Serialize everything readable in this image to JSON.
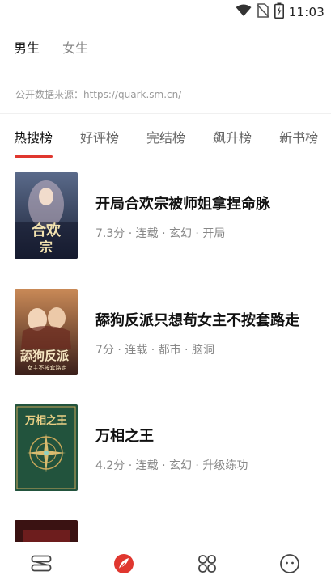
{
  "status_bar": {
    "time": "11:03",
    "icons": [
      "wifi-icon",
      "no-sim-icon",
      "battery-charging-icon"
    ]
  },
  "gender_tabs": [
    {
      "label": "男生",
      "active": true
    },
    {
      "label": "女生",
      "active": false
    }
  ],
  "source_note": "公开数据来源：https://quark.sm.cn/",
  "rank_tabs": [
    {
      "label": "热搜榜",
      "active": true
    },
    {
      "label": "好评榜",
      "active": false
    },
    {
      "label": "完结榜",
      "active": false
    },
    {
      "label": "飙升榜",
      "active": false
    },
    {
      "label": "新书榜",
      "active": false
    }
  ],
  "books": [
    {
      "title": "开局合欢宗被师姐拿捏命脉",
      "meta": "7.3分 · 连载 · 玄幻 · 开局",
      "cover_text": "合欢宗",
      "cover_colors": [
        "#1b2236",
        "#5a6a8a"
      ]
    },
    {
      "title": "舔狗反派只想苟女主不按套路走",
      "meta": "7分 · 连载 · 都市 · 脑洞",
      "cover_text": "舔狗反派",
      "cover_colors": [
        "#3a1f1a",
        "#c98a57"
      ]
    },
    {
      "title": "万相之王",
      "meta": "4.2分 · 连载 · 玄幻 · 升级练功",
      "cover_text": "万相之王",
      "cover_colors": [
        "#1d4a36",
        "#2f6b4d"
      ]
    },
    {
      "title": "",
      "meta": "",
      "cover_text": "",
      "cover_colors": [
        "#2a0f0f",
        "#7a2020"
      ]
    }
  ],
  "bottom_nav": [
    {
      "icon": "bookshelf-icon",
      "active": false
    },
    {
      "icon": "discover-feather-icon",
      "active": true
    },
    {
      "icon": "category-grid-icon",
      "active": false
    },
    {
      "icon": "profile-face-icon",
      "active": false
    }
  ],
  "colors": {
    "accent": "#e0372f",
    "text_primary": "#111111",
    "text_secondary": "#888888"
  }
}
